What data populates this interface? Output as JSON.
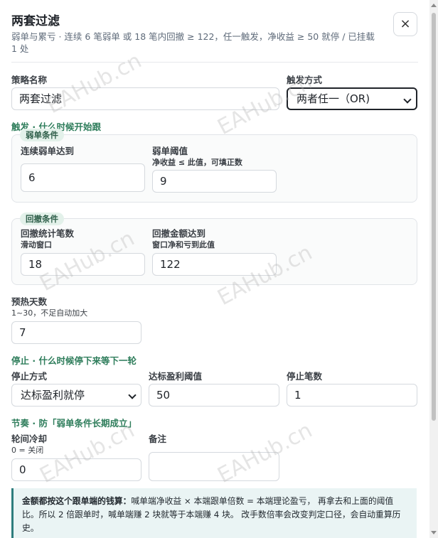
{
  "dialog": {
    "title": "两套过滤",
    "subtitle": "弱单与累亏 · 连续 6 笔弱单 或 18 笔内回撤 ≥ 122，任一触发，净收益 ≥ 50 就停 / 已挂载 1 处",
    "close_label": "×"
  },
  "fields": {
    "strategy_name_label": "策略名称",
    "strategy_name_value": "两套过滤",
    "trigger_mode_label": "触发方式",
    "trigger_mode_value": "两者任一（OR)"
  },
  "trigger_section": {
    "title": "触发 · 什么时候开始跟",
    "weak": {
      "chip": "弱单条件",
      "consecutive_label": "连续弱单达到",
      "consecutive_value": "6",
      "threshold_label": "弱单阈值",
      "threshold_hint": "净收益 ≤ 此值，可填正数",
      "threshold_value": "9"
    },
    "drawdown": {
      "chip": "回撤条件",
      "count_label": "回撤统计笔数",
      "count_hint": "滑动窗口",
      "count_value": "18",
      "amount_label": "回撤金额达到",
      "amount_hint": "窗口净和亏到此值",
      "amount_value": "122"
    },
    "warmup_label": "预热天数",
    "warmup_hint": "1~30，不足自动加大",
    "warmup_value": "7"
  },
  "stop_section": {
    "title": "停止 · 什么时候停下来等下一轮",
    "mode_label": "停止方式",
    "mode_value": "达标盈利就停",
    "profit_label": "达标盈利阈值",
    "profit_value": "50",
    "count_label": "停止笔数",
    "count_value": "1"
  },
  "rhythm_section": {
    "title": "节奏 · 防「弱单条件长期成立」",
    "cooldown_label": "轮间冷却",
    "cooldown_hint": "0 = 关闭",
    "cooldown_value": "0",
    "note_label": "备注",
    "note_value": ""
  },
  "info": {
    "bold_lead": "金额都按这个跟单端的钱算：",
    "text": "喊单端净收益 × 本端跟单倍数 = 本端理论盈亏， 再拿去和上面的阈值比。所以 2 倍跟单时，喊单端赚 2 块就等于本端赚 4 块。 改手数倍率会改变判定口径，会自动重算历史。"
  },
  "watermark": "EAHub.cn"
}
